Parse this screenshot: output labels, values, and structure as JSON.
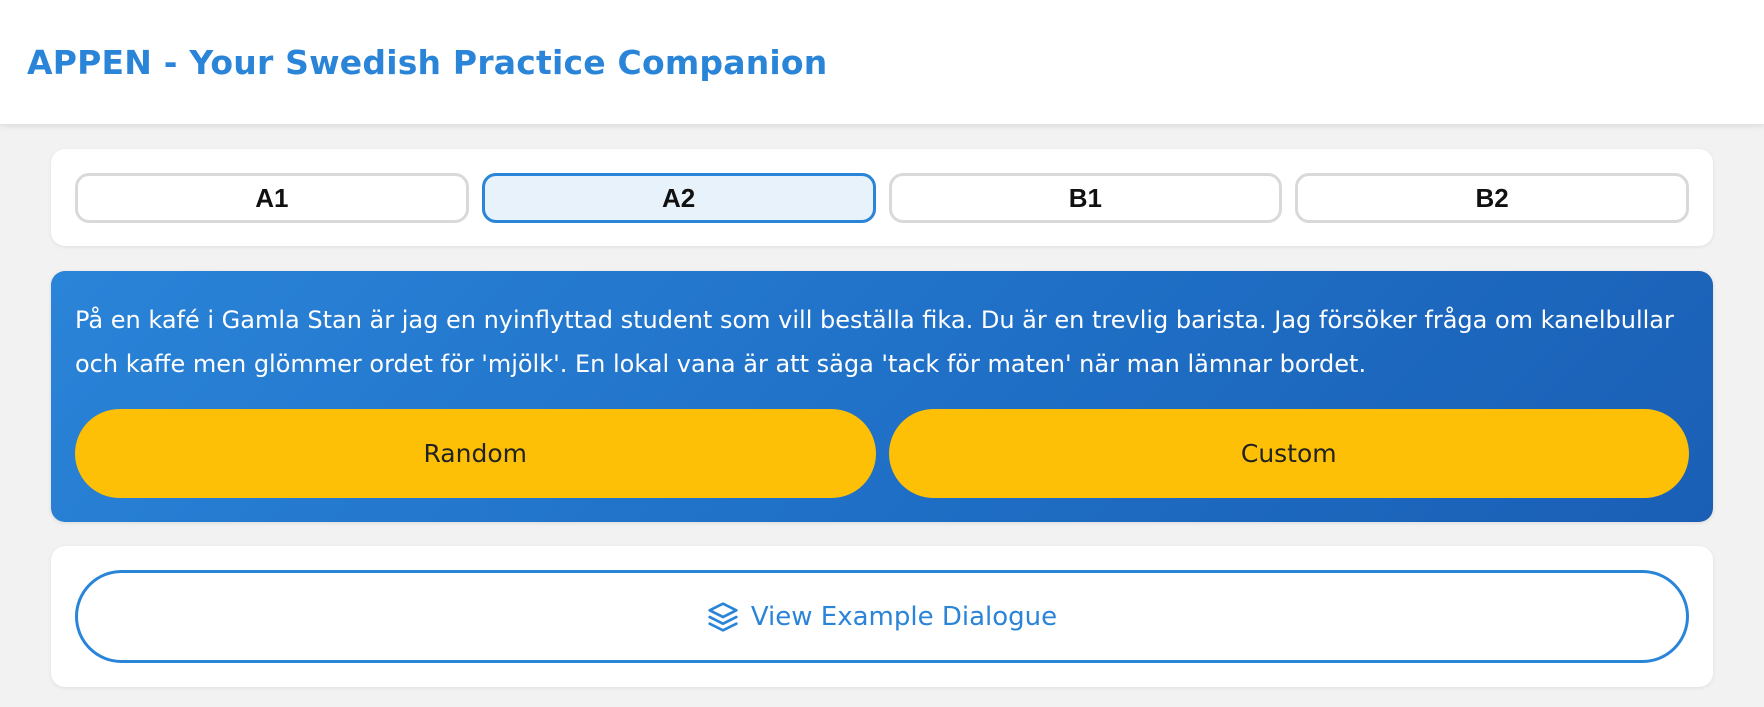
{
  "header": {
    "title": "APPEN - Your Swedish Practice Companion"
  },
  "levels": {
    "items": [
      {
        "label": "A1",
        "selected": false
      },
      {
        "label": "A2",
        "selected": true
      },
      {
        "label": "B1",
        "selected": false
      },
      {
        "label": "B2",
        "selected": false
      }
    ]
  },
  "scenario": {
    "text": "På en kafé i Gamla Stan är jag en nyinflyttad student som vill beställa fika. Du är en trevlig barista. Jag försöker fråga om kanelbullar och kaffe men glömmer ordet för 'mjölk'. En lokal vana är att säga 'tack för maten' när man lämnar bordet.",
    "random_label": "Random",
    "custom_label": "Custom"
  },
  "example": {
    "button_label": "View Example Dialogue",
    "icon": "layers-icon"
  },
  "colors": {
    "accent": "#2a84d8",
    "button_yellow": "#fdc006",
    "background": "#f2f2f2"
  }
}
